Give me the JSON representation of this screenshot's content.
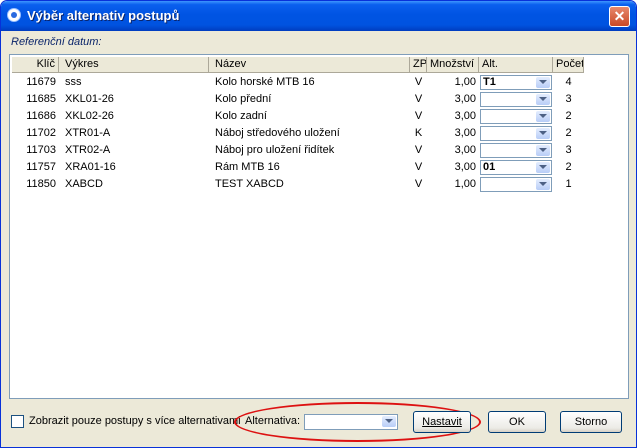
{
  "window": {
    "title": "Výběr alternativ postupů",
    "close_symbol": "✕"
  },
  "ref_label": "Referenční datum:",
  "columns": {
    "klic": "Klíč",
    "vykres": "Výkres",
    "nazev": "Název",
    "zp": "ZP",
    "mnozstvi": "Množství",
    "alt": "Alt.",
    "pocet": "Počet"
  },
  "rows": [
    {
      "klic": "11679",
      "vykres": "sss",
      "nazev": "Kolo horské MTB 16",
      "zp": "V",
      "mnozstvi": "1,00",
      "alt": "T1",
      "pocet": "4"
    },
    {
      "klic": "11685",
      "vykres": "XKL01-26",
      "nazev": "Kolo přední",
      "zp": "V",
      "mnozstvi": "3,00",
      "alt": "",
      "pocet": "3"
    },
    {
      "klic": "11686",
      "vykres": "XKL02-26",
      "nazev": "Kolo zadní",
      "zp": "V",
      "mnozstvi": "3,00",
      "alt": "",
      "pocet": "2"
    },
    {
      "klic": "11702",
      "vykres": "XTR01-A",
      "nazev": "Náboj středového uložení",
      "zp": "K",
      "mnozstvi": "3,00",
      "alt": "",
      "pocet": "2"
    },
    {
      "klic": "11703",
      "vykres": "XTR02-A",
      "nazev": "Náboj pro uložení řidítek",
      "zp": "V",
      "mnozstvi": "3,00",
      "alt": "",
      "pocet": "3"
    },
    {
      "klic": "11757",
      "vykres": "XRA01-16",
      "nazev": "Rám MTB 16",
      "zp": "V",
      "mnozstvi": "3,00",
      "alt": "01",
      "pocet": "2"
    },
    {
      "klic": "11850",
      "vykres": "XABCD",
      "nazev": "TEST XABCD",
      "zp": "V",
      "mnozstvi": "1,00",
      "alt": "",
      "pocet": "1"
    }
  ],
  "bottom": {
    "checkbox_label": "Zobrazit pouze postupy s více alternativami",
    "alt_label": "Alternativa:",
    "alt_value": "",
    "nastavit": "Nastavit",
    "ok": "OK",
    "storno": "Storno"
  },
  "colors": {
    "titlebar": "#0054E3",
    "highlight_ellipse": "#DD1111"
  }
}
